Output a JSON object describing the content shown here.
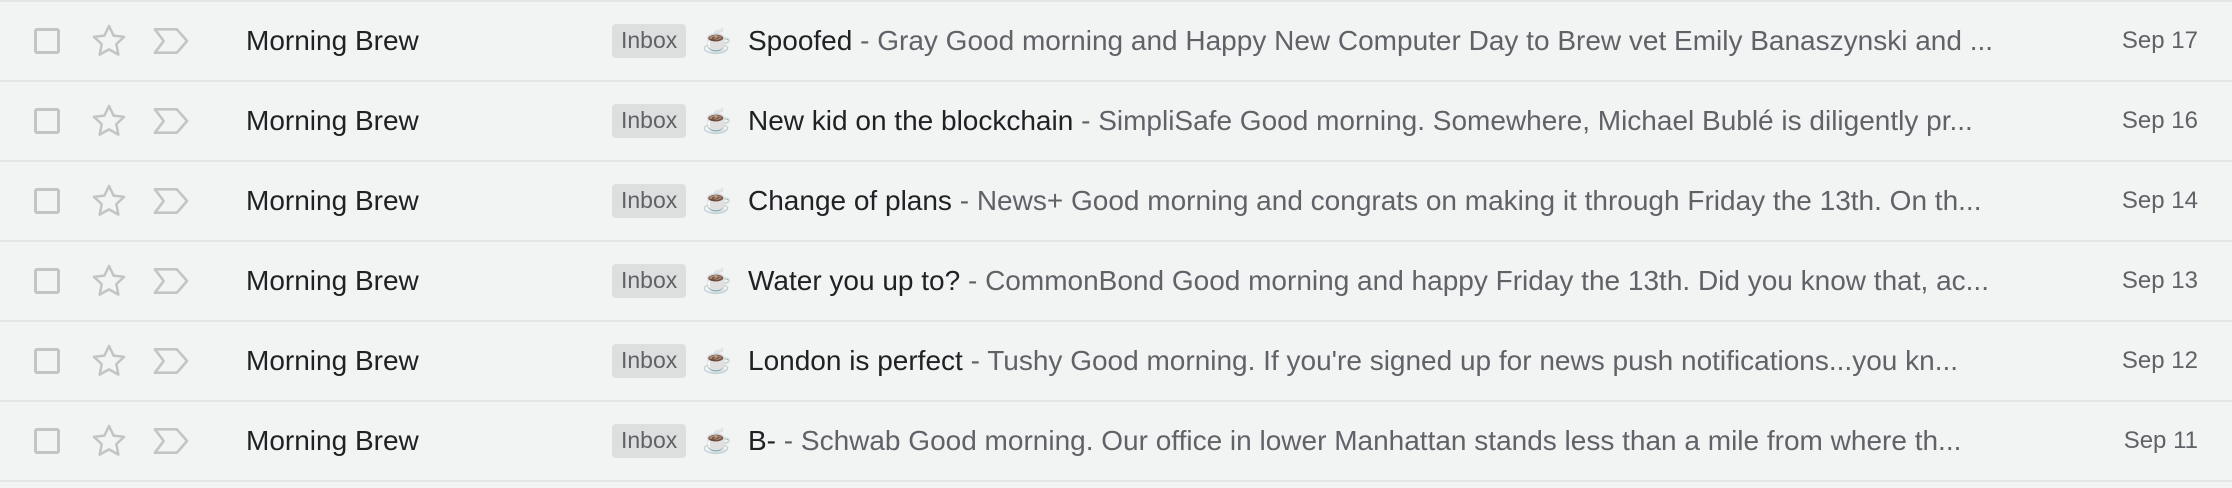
{
  "emails": [
    {
      "sender": "Morning Brew",
      "label": "Inbox",
      "emoji": "☕",
      "subject": "Spoofed",
      "separator": " - ",
      "snippet": "Gray Good morning and Happy New Computer Day to Brew vet Emily Banaszynski and ...",
      "date": "Sep 17"
    },
    {
      "sender": "Morning Brew",
      "label": "Inbox",
      "emoji": "☕",
      "subject": "New kid on the blockchain",
      "separator": " - ",
      "snippet": "SimpliSafe Good morning. Somewhere, Michael Bublé is diligently pr...",
      "date": "Sep 16"
    },
    {
      "sender": "Morning Brew",
      "label": "Inbox",
      "emoji": "☕",
      "subject": "Change of plans",
      "separator": " - ",
      "snippet": "News+ Good morning and congrats on making it through Friday the 13th. On th...",
      "date": "Sep 14"
    },
    {
      "sender": "Morning Brew",
      "label": "Inbox",
      "emoji": "☕",
      "subject": "Water you up to?",
      "separator": " - ",
      "snippet": "CommonBond Good morning and happy Friday the 13th. Did you know that, ac...",
      "date": "Sep 13"
    },
    {
      "sender": "Morning Brew",
      "label": "Inbox",
      "emoji": "☕",
      "subject": "London is perfect",
      "separator": " - ",
      "snippet": "Tushy Good morning. If you're signed up for news push notifications...you kn...",
      "date": "Sep 12"
    },
    {
      "sender": "Morning Brew",
      "label": "Inbox",
      "emoji": "☕",
      "subject": "B-",
      "separator": " - ",
      "snippet": "Schwab Good morning. Our office in lower Manhattan stands less than a mile from where th...",
      "date": "Sep 11"
    }
  ],
  "colors": {
    "row_background": "#f2f4f3",
    "divider": "#e2e5e3",
    "icon_gray": "#c2c5c3",
    "label_background": "#dcdfdd",
    "text_primary": "#202124",
    "text_secondary": "#5f6368"
  },
  "icons": {
    "checkbox": "checkbox-icon",
    "star": "star-icon",
    "important": "important-marker-icon"
  }
}
